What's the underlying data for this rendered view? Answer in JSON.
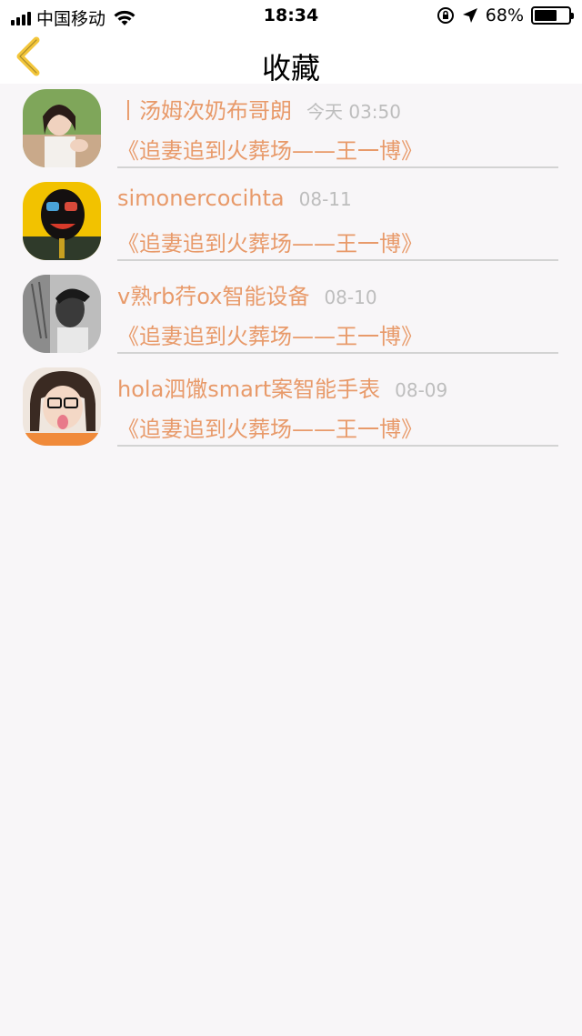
{
  "status_bar": {
    "carrier": "中国移动",
    "time": "18:34",
    "battery_percent_text": "68%",
    "battery_level": 0.68
  },
  "nav": {
    "title": "收藏",
    "back_icon": "chevron-left-icon",
    "back_color": "#f3c63b"
  },
  "colors": {
    "accent": "#e89a6a",
    "time_gray": "#bdbdbd",
    "background": "#f8f6f8"
  },
  "items": [
    {
      "name": "丨汤姆次奶布哥朗",
      "time": "今天 03:50",
      "subtitle": "《追妻追到火葬场——王一博》"
    },
    {
      "name": "simonercocihta",
      "time": "08-11",
      "subtitle": "《追妻追到火葬场——王一博》"
    },
    {
      "name": "v熟rb荇ox智能设备",
      "time": "08-10",
      "subtitle": "《追妻追到火葬场——王一博》"
    },
    {
      "name": "hola泗馓smart案智能手表",
      "time": "08-09",
      "subtitle": "《追妻追到火葬场——王一博》"
    }
  ]
}
